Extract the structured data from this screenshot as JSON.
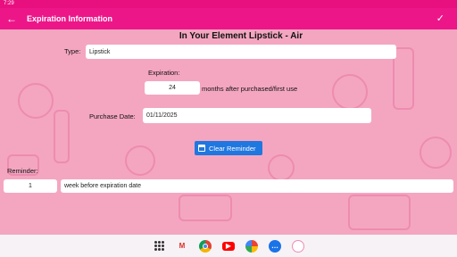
{
  "status_bar": {
    "time": "7:29"
  },
  "app_bar": {
    "title": "Expiration Information",
    "back_icon": "arrow-back-icon",
    "confirm_icon": "check-icon"
  },
  "product": {
    "name": "In Your Element Lipstick - Air"
  },
  "type": {
    "label": "Type:",
    "value": "Lipstick"
  },
  "expiration": {
    "label": "Expiration:",
    "value": "24",
    "suffix": "months after purchased/first use"
  },
  "purchase": {
    "label": "Purchase Date:",
    "value": "01/11/2025"
  },
  "clear_button": {
    "label": "Clear Reminder",
    "icon": "calendar-icon"
  },
  "reminder": {
    "label": "Reminder:",
    "value": "1",
    "unit": "week before expiration date"
  },
  "colors": {
    "app_bar": "#ec1689",
    "background": "#f4a6c1",
    "button": "#1f77e0"
  },
  "nav_bar": {
    "icons": [
      "apps-grid-icon",
      "gmail-icon",
      "chrome-icon",
      "youtube-icon",
      "photos-icon",
      "messages-icon",
      "app-icon"
    ]
  }
}
